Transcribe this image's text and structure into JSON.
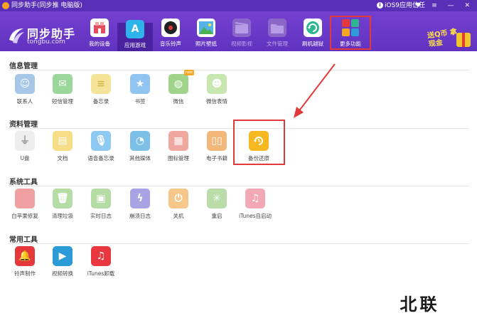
{
  "window": {
    "title": "同步助手(同步推 电脑版)",
    "ios_trust": "iOS9应用信任",
    "controls": "♥ ≡ — ✕"
  },
  "brand": {
    "name": "同步助手",
    "domain": "tongbu.com"
  },
  "nav": {
    "items": [
      {
        "label": "我的设备",
        "icon": "device-icon",
        "color": "#e44d5e"
      },
      {
        "label": "应用游戏",
        "icon": "appstore-icon",
        "color": "#2eb4ea"
      },
      {
        "label": "音乐铃声",
        "icon": "music-disc-icon",
        "color": "#222222"
      },
      {
        "label": "照片壁纸",
        "icon": "photo-icon",
        "color": "#55b3e8"
      },
      {
        "label": "视频影视",
        "icon": "video-icon",
        "color": "#8a67c9"
      },
      {
        "label": "文件管理",
        "icon": "folder-icon",
        "color": "#8a67c9"
      },
      {
        "label": "刷机越狱",
        "icon": "refresh-icon",
        "color": "#2fb58f"
      },
      {
        "label": "更多功能",
        "icon": "more-grid-icon",
        "color": "#f5a623"
      }
    ],
    "promo_text": "送Q币 拿现金"
  },
  "sections": [
    {
      "title": "信息管理",
      "items": [
        {
          "label": "联系人",
          "icon": "contacts-icon",
          "color": "#a6c7e8"
        },
        {
          "label": "短信管理",
          "icon": "sms-icon",
          "color": "#9bd79a"
        },
        {
          "label": "备忘录",
          "icon": "notes-icon",
          "color": "#f5e39a"
        },
        {
          "label": "书签",
          "icon": "bookmark-icon",
          "color": "#8fc3f0"
        },
        {
          "label": "微信",
          "icon": "wechat-icon",
          "color": "#9fd48a",
          "tag": "new"
        },
        {
          "label": "微信表情",
          "icon": "emoji-icon",
          "color": "#c8e6b0"
        }
      ]
    },
    {
      "title": "资料管理",
      "items": [
        {
          "label": "U盘",
          "icon": "usb-icon",
          "color": "#eeeeee"
        },
        {
          "label": "文档",
          "icon": "document-icon",
          "color": "#f7dd86"
        },
        {
          "label": "语音备忘录",
          "icon": "mic-icon",
          "color": "#8ec9f2"
        },
        {
          "label": "其他媒体",
          "icon": "media-icon",
          "color": "#7cc0e8"
        },
        {
          "label": "图标管理",
          "icon": "icon-grid-icon",
          "color": "#f0a7a0"
        },
        {
          "label": "电子书籍",
          "icon": "ebook-icon",
          "color": "#f3b77a"
        },
        {
          "label": "备份还原",
          "icon": "backup-restore-icon",
          "color": "#f5b820"
        }
      ]
    },
    {
      "title": "系统工具",
      "items": [
        {
          "label": "白苹果修复",
          "icon": "apple-repair-icon",
          "color": "#f0a0a0"
        },
        {
          "label": "清理垃圾",
          "icon": "trash-icon",
          "color": "#b6dca6"
        },
        {
          "label": "实时日志",
          "icon": "log-icon",
          "color": "#b6dca6"
        },
        {
          "label": "崩溃日志",
          "icon": "crash-log-icon",
          "color": "#a8a3e2"
        },
        {
          "label": "关机",
          "icon": "power-icon",
          "color": "#f5c78a"
        },
        {
          "label": "重启",
          "icon": "restart-icon",
          "color": "#b9dca9"
        },
        {
          "label": "iTunes自启动",
          "icon": "itunes-startup-icon",
          "color": "#f3a8b6"
        }
      ]
    },
    {
      "title": "常用工具",
      "items": [
        {
          "label": "铃声制作",
          "icon": "ringtone-icon",
          "color": "#e5383b"
        },
        {
          "label": "视频转换",
          "icon": "video-convert-icon",
          "color": "#2d9bd8"
        },
        {
          "label": "iTunes卸载",
          "icon": "itunes-uninstall-icon",
          "color": "#e8373f"
        }
      ]
    }
  ],
  "watermark": "北联"
}
